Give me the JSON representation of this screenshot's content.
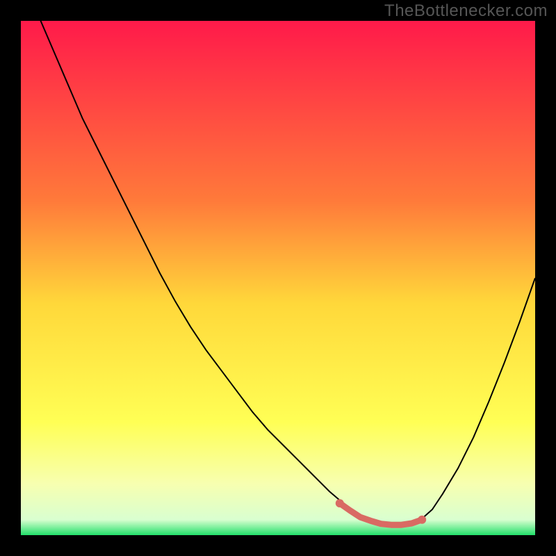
{
  "watermark": "TheBottlenecker.com",
  "gradient": {
    "stops": [
      {
        "offset": "0%",
        "color": "#ff1a4a"
      },
      {
        "offset": "35%",
        "color": "#ff7a3a"
      },
      {
        "offset": "55%",
        "color": "#ffd83a"
      },
      {
        "offset": "78%",
        "color": "#ffff55"
      },
      {
        "offset": "90%",
        "color": "#f7ffb0"
      },
      {
        "offset": "97%",
        "color": "#d9ffd0"
      },
      {
        "offset": "100%",
        "color": "#22e06a"
      }
    ]
  },
  "colors": {
    "frame_bg": "#000000",
    "line": "#000000",
    "highlight": "#d96a63"
  },
  "chart_data": {
    "type": "line",
    "title": "",
    "xlabel": "",
    "ylabel": "",
    "xlim": [
      0,
      100
    ],
    "ylim": [
      0,
      100
    ],
    "x": [
      0,
      3,
      6,
      9,
      12,
      15,
      18,
      21,
      24,
      27,
      30,
      33,
      36,
      39,
      42,
      45,
      48,
      51,
      54,
      56,
      58,
      60,
      62,
      64,
      66,
      68,
      70,
      72,
      74,
      76,
      78,
      80,
      82,
      85,
      88,
      91,
      94,
      97,
      100
    ],
    "series": [
      {
        "name": "curve",
        "values": [
          110,
          102,
          95,
          88,
          81,
          75,
          69,
          63,
          57,
          51,
          45.5,
          40.5,
          36,
          32,
          28,
          24,
          20.5,
          17.5,
          14.5,
          12.5,
          10.5,
          8.5,
          6.8,
          5.2,
          3.8,
          2.8,
          2.0,
          1.7,
          1.7,
          2.1,
          3.2,
          5.0,
          8.0,
          13.0,
          19.0,
          26.0,
          33.5,
          41.5,
          50.0
        ]
      }
    ],
    "highlight": {
      "x": [
        62,
        64,
        66,
        68,
        70,
        72,
        74,
        76,
        78
      ],
      "values": [
        6.2,
        4.8,
        3.5,
        2.8,
        2.2,
        2.0,
        2.0,
        2.3,
        3.0
      ],
      "stroke_width": 9,
      "dot_radius": 6
    }
  }
}
